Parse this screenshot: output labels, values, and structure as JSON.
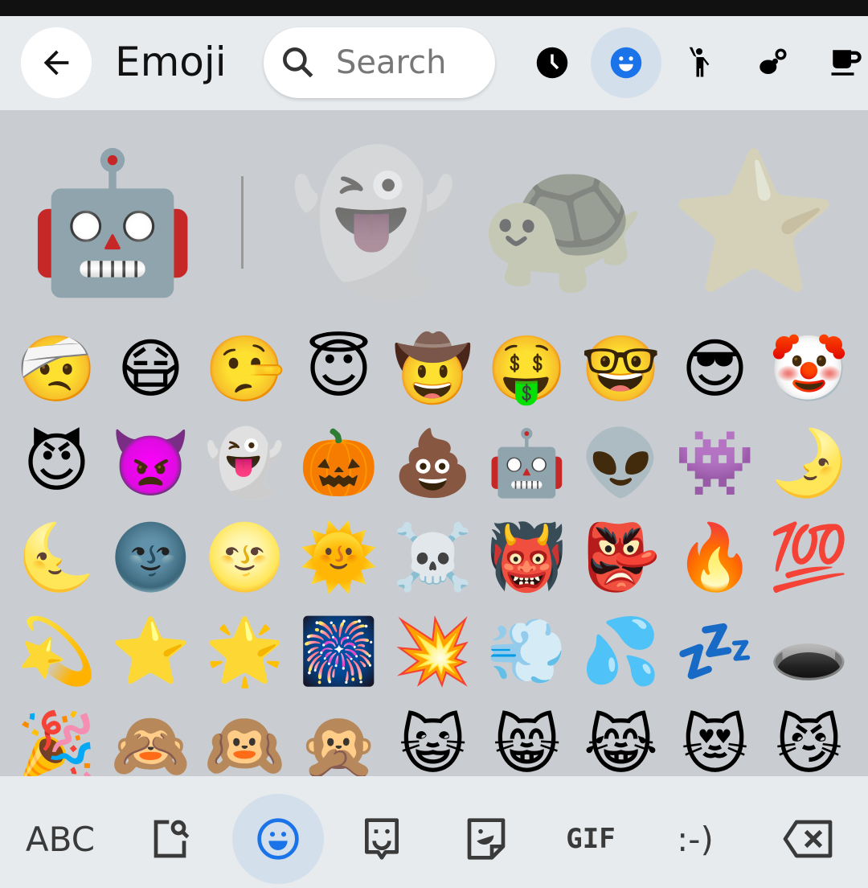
{
  "header": {
    "title": "Emoji",
    "search_placeholder": "Search",
    "categories": [
      {
        "icon": "clock-icon",
        "glyph": "🕓"
      },
      {
        "icon": "smiley-icon",
        "glyph": "☺",
        "active": true
      },
      {
        "icon": "person-waving-icon",
        "glyph": "🙋"
      },
      {
        "icon": "bee-flower-icon",
        "glyph": "🐝"
      },
      {
        "icon": "teacup-icon",
        "glyph": "☕"
      }
    ]
  },
  "featured": [
    "🤖",
    "👻",
    "🐢",
    "⭐"
  ],
  "emoji_rows": [
    [
      "🤕",
      "😷",
      "🤥",
      "😇",
      "🤠",
      "🤑",
      "🤓",
      "😎",
      "🤡"
    ],
    [
      "😈",
      "👿",
      "👻",
      "🎃",
      "💩",
      "🤖",
      "👽",
      "👾",
      "🌛"
    ],
    [
      "🌜",
      "🌚",
      "🌝",
      "🌞",
      "☠️",
      "👹",
      "👺",
      "🔥",
      "💯"
    ],
    [
      "💫",
      "⭐",
      "🌟",
      "🎆",
      "💥",
      "💨",
      "💦",
      "💤",
      "🕳️"
    ],
    [
      "🎉",
      "🙈",
      "🙉",
      "🙊",
      "😺",
      "😸",
      "😹",
      "😻",
      "😼"
    ]
  ],
  "bottom": {
    "abc": "ABC",
    "gif": "GIF",
    "emoticon": ":-)"
  },
  "colors": {
    "accent": "#1a73e8",
    "active_bg": "#d3dfeb"
  }
}
